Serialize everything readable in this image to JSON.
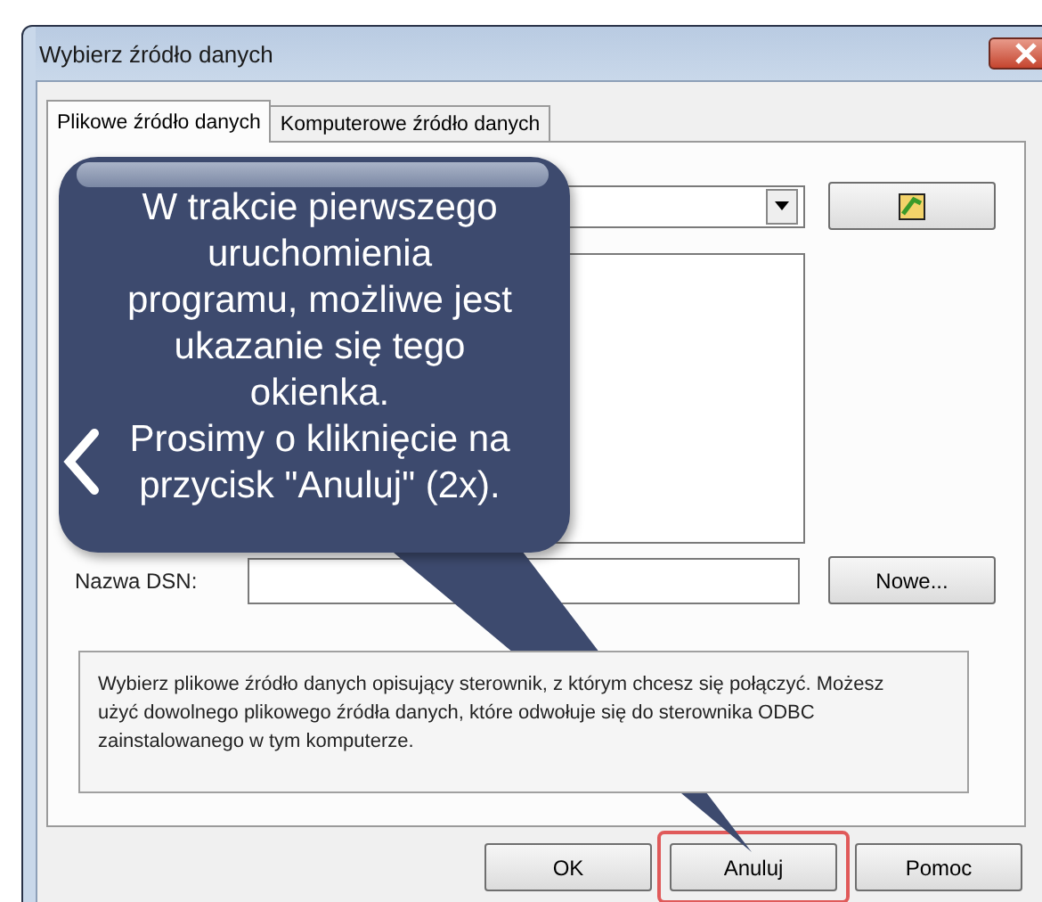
{
  "window": {
    "title": "Wybierz źródło danych"
  },
  "tabs": [
    {
      "label": "Plikowe źródło danych",
      "selected": true
    },
    {
      "label": "Komputerowe źródło danych",
      "selected": false
    }
  ],
  "dsn_field": {
    "label": "Nazwa DSN:"
  },
  "new_button": "Nowe...",
  "description": "Wybierz plikowe źródło danych opisujący sterownik, z którym chcesz się połączyć. Możesz użyć dowolnego plikowego źródła danych, które odwołuje się do sterownika ODBC zainstalowanego w tym komputerze.",
  "buttons": [
    {
      "label": "OK",
      "highlighted": false
    },
    {
      "label": "Anuluj",
      "highlighted": true
    },
    {
      "label": "Pomoc",
      "highlighted": false
    }
  ],
  "callout": {
    "text": "W trakcie pierwszego\nuruchomienia\nprogramu, możliwe jest\nukazanie się tego\nokienka.\nProsimy o kliknięcie na\nprzycisk \"Anuluj\" (2x)."
  }
}
